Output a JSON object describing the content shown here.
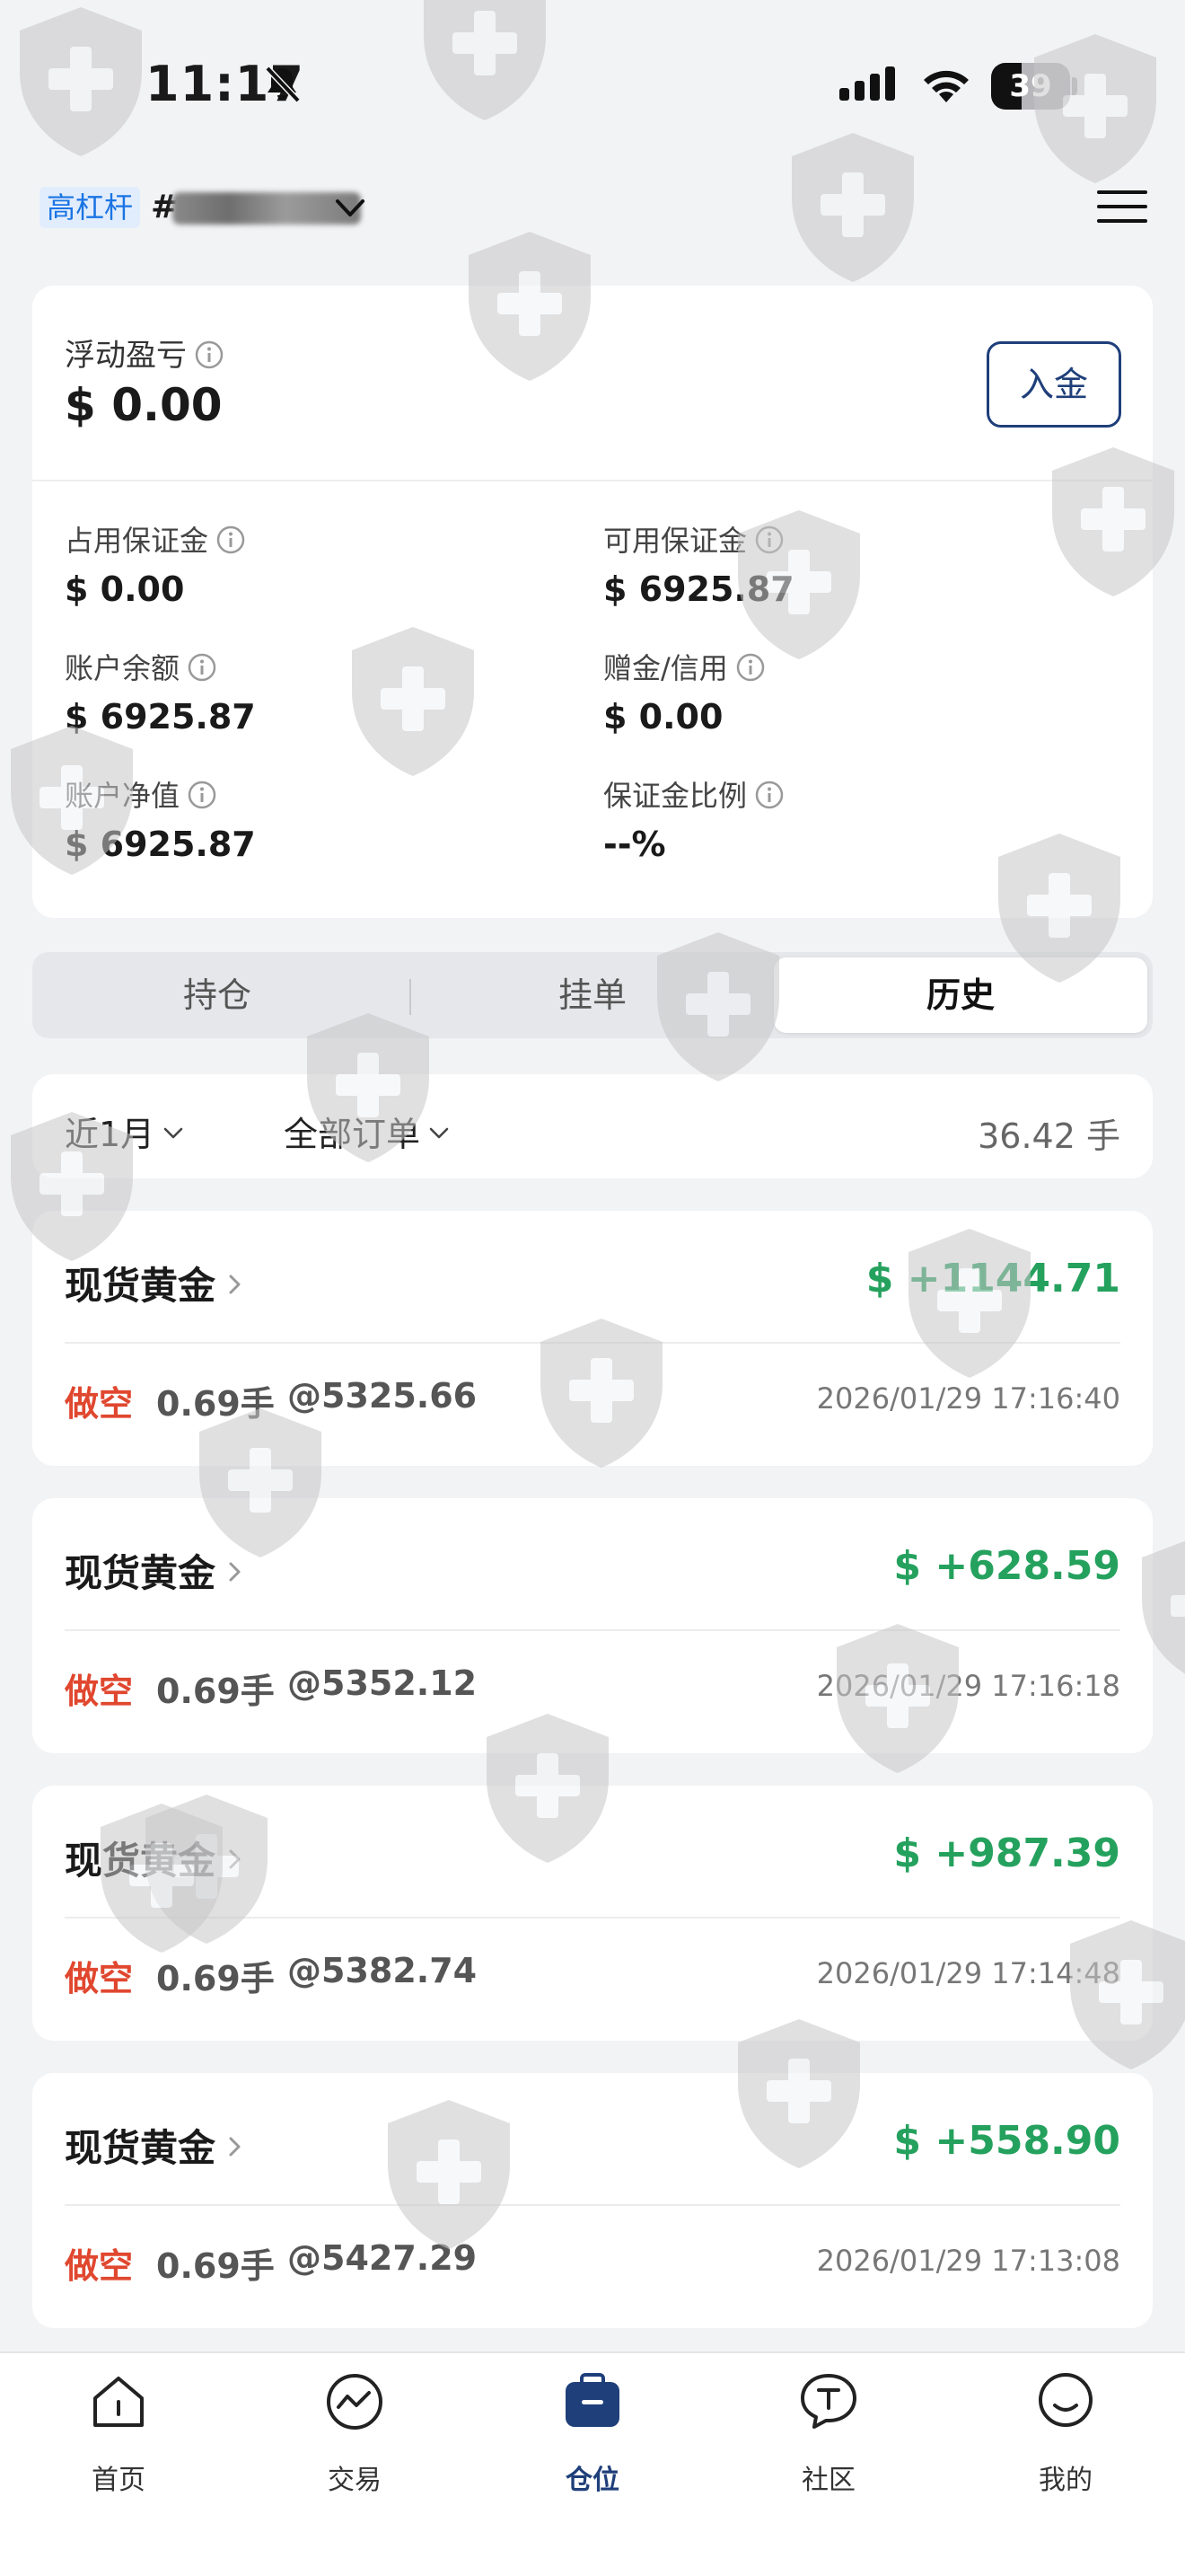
{
  "status_bar": {
    "time": "11:17",
    "battery": "39",
    "battery_level": 0.39,
    "icons": [
      "bell-off-icon",
      "signal-icon",
      "wifi-icon",
      "battery-icon"
    ]
  },
  "header": {
    "leverage_badge": "高杠杆",
    "account_prefix": "#",
    "menu_icon": "hamburger-menu-icon"
  },
  "account": {
    "floating_pnl_label": "浮动盈亏",
    "floating_pnl_value": "$ 0.00",
    "deposit_label": "入金",
    "metrics": [
      {
        "label": "占用保证金",
        "value": "$ 0.00"
      },
      {
        "label": "可用保证金",
        "value": "$ 6925.87"
      },
      {
        "label": "账户余额",
        "value": "$ 6925.87"
      },
      {
        "label": "赠金/信用",
        "value": "$ 0.00"
      },
      {
        "label": "账户净值",
        "value": "$ 6925.87"
      },
      {
        "label": "保证金比例",
        "value": "--%"
      }
    ]
  },
  "tabs": [
    {
      "label": "持仓"
    },
    {
      "label": "挂单"
    },
    {
      "label": "历史",
      "active": true
    }
  ],
  "filters": {
    "period": "近1月",
    "order_type": "全部订单",
    "total_lots": "36.42 手"
  },
  "trades": [
    {
      "name": "现货黄金",
      "pnl": "$ +1144.71",
      "side": "做空",
      "lots": "0.69手",
      "price": "@5325.66",
      "time": "2026/01/29 17:16:40"
    },
    {
      "name": "现货黄金",
      "pnl": "$ +628.59",
      "side": "做空",
      "lots": "0.69手",
      "price": "@5352.12",
      "time": "2026/01/29 17:16:18"
    },
    {
      "name": "现货黄金",
      "pnl": "$ +987.39",
      "side": "做空",
      "lots": "0.69手",
      "price": "@5382.74",
      "time": "2026/01/29 17:14:48"
    },
    {
      "name": "现货黄金",
      "pnl": "$ +558.90",
      "side": "做空",
      "lots": "0.69手",
      "price": "@5427.29",
      "time": "2026/01/29 17:13:08"
    }
  ],
  "colors": {
    "profit_green": "#25a15e",
    "short_red": "#e0472f",
    "brand_navy": "#1f3f7a",
    "badge_blue": "#1b74e4"
  },
  "bottom_nav": [
    {
      "label": "首页",
      "icon": "home-icon"
    },
    {
      "label": "交易",
      "icon": "trade-chart-icon"
    },
    {
      "label": "仓位",
      "icon": "briefcase-icon",
      "active": true
    },
    {
      "label": "社区",
      "icon": "community-chat-icon"
    },
    {
      "label": "我的",
      "icon": "profile-face-icon"
    }
  ]
}
